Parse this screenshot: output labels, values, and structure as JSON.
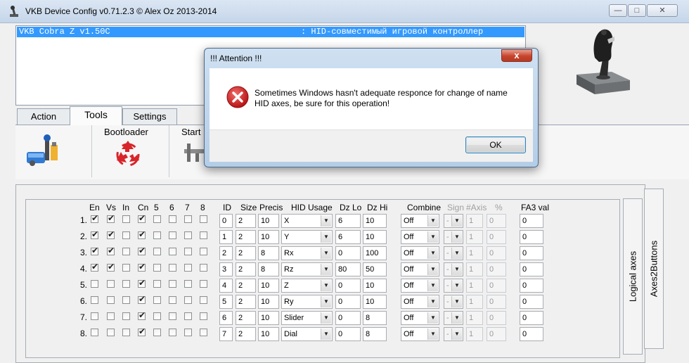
{
  "window": {
    "title": "VKB Device Config v0.71.2.3 © Alex Oz 2013-2014",
    "min_glyph": "—",
    "max_glyph": "□",
    "close_glyph": "✕"
  },
  "device_list": {
    "items": [
      {
        "name": "VKB Cobra Z v1.50C",
        "description": ": HID-совместимый игровой контроллер",
        "selected": true
      }
    ]
  },
  "tabs": [
    {
      "label": "Action",
      "active": false
    },
    {
      "label": "Tools",
      "active": true
    },
    {
      "label": "Settings",
      "active": false
    }
  ],
  "tools": {
    "bootloader_label": "Bootloader",
    "start_label": "Start"
  },
  "grid": {
    "headers": {
      "en": "En",
      "vs": "Vs",
      "in": "In",
      "cn": "Cn",
      "c5": "5",
      "c6": "6",
      "c7": "7",
      "c8": "8",
      "id": "ID",
      "size": "Size",
      "precis": "Precis",
      "hid_usage": "HID Usage",
      "dz_lo": "Dz Lo",
      "dz_hi": "Dz Hi",
      "combine": "Combine",
      "sign": "Sign",
      "naxis": "#Axis",
      "pct": "%",
      "fa3": "FA3 val"
    },
    "rows": [
      {
        "num": "1.",
        "en": true,
        "vs": true,
        "in": false,
        "cn": true,
        "id": "0",
        "size": "2",
        "precis": "10",
        "hid": "X",
        "dzlo": "6",
        "dzhi": "10",
        "combine": "Off",
        "sign": "-",
        "naxis": "1",
        "pct": "0",
        "fa3": "0"
      },
      {
        "num": "2.",
        "en": true,
        "vs": true,
        "in": false,
        "cn": true,
        "id": "1",
        "size": "2",
        "precis": "10",
        "hid": "Y",
        "dzlo": "6",
        "dzhi": "10",
        "combine": "Off",
        "sign": "-",
        "naxis": "1",
        "pct": "0",
        "fa3": "0"
      },
      {
        "num": "3.",
        "en": true,
        "vs": true,
        "in": false,
        "cn": true,
        "id": "2",
        "size": "2",
        "precis": "8",
        "hid": "Rx",
        "dzlo": "0",
        "dzhi": "100",
        "combine": "Off",
        "sign": "-",
        "naxis": "1",
        "pct": "0",
        "fa3": "0"
      },
      {
        "num": "4.",
        "en": true,
        "vs": true,
        "in": false,
        "cn": true,
        "id": "3",
        "size": "2",
        "precis": "8",
        "hid": "Rz",
        "dzlo": "80",
        "dzhi": "50",
        "combine": "Off",
        "sign": "-",
        "naxis": "1",
        "pct": "0",
        "fa3": "0"
      },
      {
        "num": "5.",
        "en": false,
        "vs": false,
        "in": false,
        "cn": true,
        "id": "4",
        "size": "2",
        "precis": "10",
        "hid": "Z",
        "dzlo": "0",
        "dzhi": "10",
        "combine": "Off",
        "sign": "-",
        "naxis": "1",
        "pct": "0",
        "fa3": "0"
      },
      {
        "num": "6.",
        "en": false,
        "vs": false,
        "in": false,
        "cn": true,
        "id": "5",
        "size": "2",
        "precis": "10",
        "hid": "Ry",
        "dzlo": "0",
        "dzhi": "10",
        "combine": "Off",
        "sign": "-",
        "naxis": "1",
        "pct": "0",
        "fa3": "0"
      },
      {
        "num": "7.",
        "en": false,
        "vs": false,
        "in": false,
        "cn": true,
        "id": "6",
        "size": "2",
        "precis": "10",
        "hid": "Slider",
        "dzlo": "0",
        "dzhi": "8",
        "combine": "Off",
        "sign": "-",
        "naxis": "1",
        "pct": "0",
        "fa3": "0"
      },
      {
        "num": "8.",
        "en": false,
        "vs": false,
        "in": false,
        "cn": true,
        "id": "7",
        "size": "2",
        "precis": "10",
        "hid": "Dial",
        "dzlo": "0",
        "dzhi": "8",
        "combine": "Off",
        "sign": "-",
        "naxis": "1",
        "pct": "0",
        "fa3": "0"
      }
    ]
  },
  "side_tabs": {
    "logical_axes": "Logical axes",
    "axes2buttons": "Axes2Buttons"
  },
  "dialog": {
    "title": "!!! Attention !!!",
    "close_glyph": "x",
    "message": "Sometimes Windows hasn't adequate responce for change of name HID axes, be sure for this operation!",
    "ok_label": "OK",
    "icon": "error-icon"
  },
  "check_glyph": "✔",
  "colors": {
    "selection": "#3399ff",
    "error_red": "#d42a2a"
  }
}
